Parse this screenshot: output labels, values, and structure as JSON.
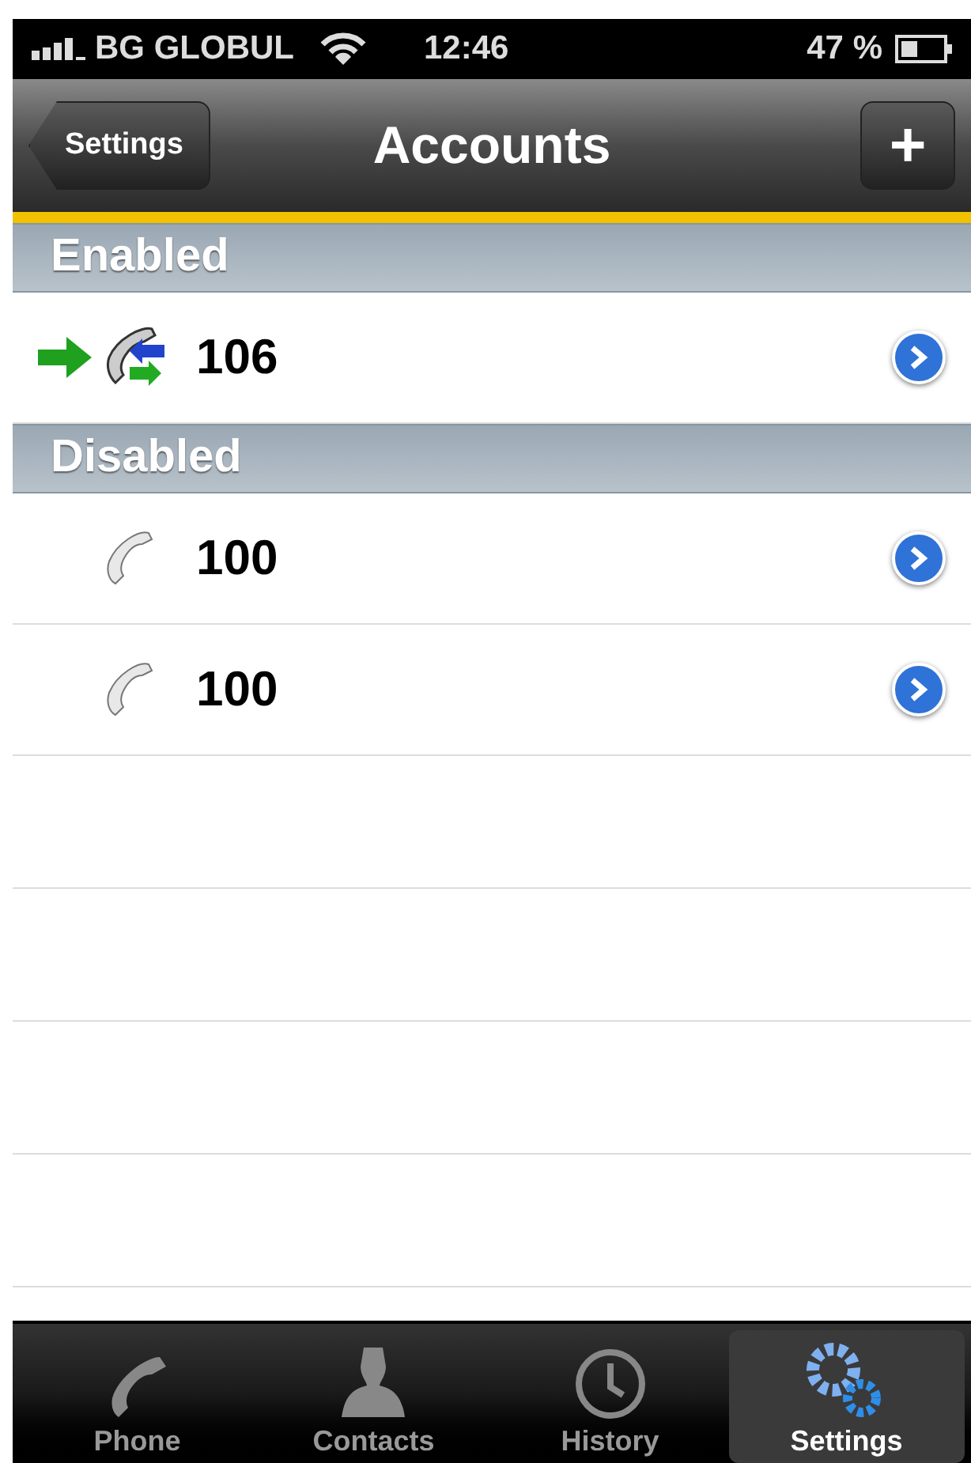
{
  "status_bar": {
    "carrier": "BG GLOBUL",
    "time": "12:46",
    "battery": "47 %"
  },
  "nav_bar": {
    "back": "Settings",
    "title": "Accounts",
    "add": "+"
  },
  "sections": [
    {
      "kind": "enabled",
      "title": "Enabled",
      "accounts": [
        {
          "name": "106",
          "active": true
        }
      ]
    },
    {
      "kind": "disabled",
      "title": "Disabled",
      "accounts": [
        {
          "name": "100",
          "active": false
        },
        {
          "name": "100",
          "active": false
        }
      ]
    }
  ],
  "tabs": [
    {
      "label": "Phone",
      "selected": false
    },
    {
      "label": "Contacts",
      "selected": false
    },
    {
      "label": "History",
      "selected": false
    },
    {
      "label": "Settings",
      "selected": true
    }
  ]
}
